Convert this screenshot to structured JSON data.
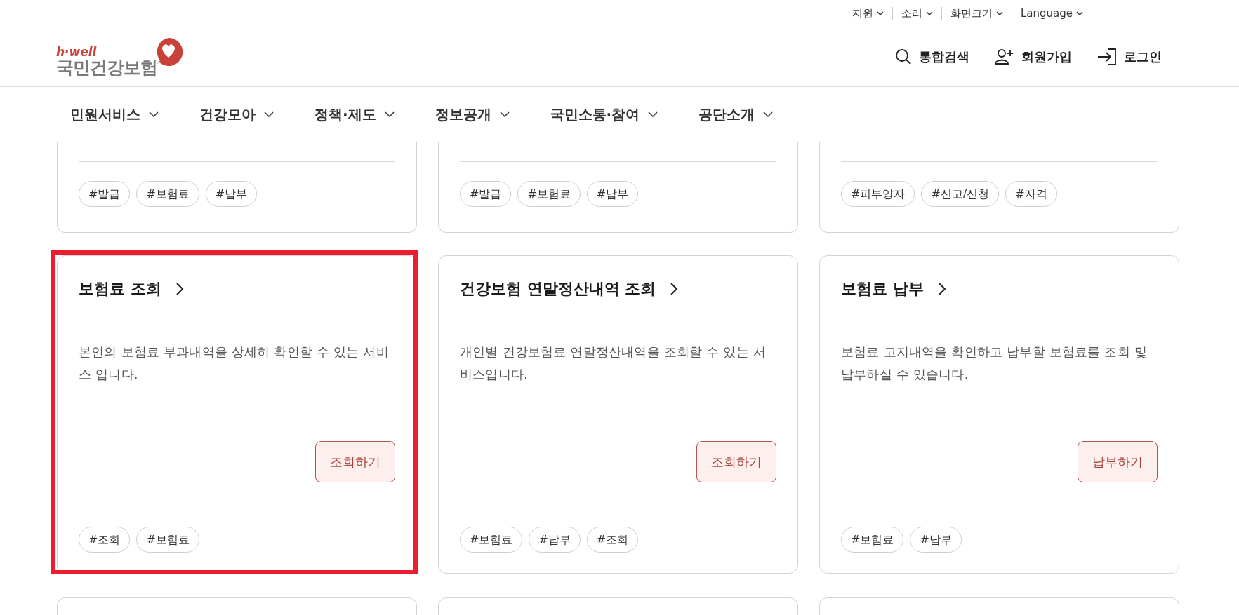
{
  "utility_menu": [
    {
      "label": "지원"
    },
    {
      "label": "소리"
    },
    {
      "label": "화면크기"
    },
    {
      "label": "Language"
    }
  ],
  "logo": {
    "tagline": "h·well",
    "name": "국민건강보험"
  },
  "header_actions": [
    {
      "label": "통합검색",
      "kind": "search"
    },
    {
      "label": "회원가입",
      "kind": "signup"
    },
    {
      "label": "로그인",
      "kind": "login"
    }
  ],
  "main_nav": [
    {
      "label": "민원서비스"
    },
    {
      "label": "건강모아"
    },
    {
      "label": "정책·제도"
    },
    {
      "label": "정보공개"
    },
    {
      "label": "국민소통·참여"
    },
    {
      "label": "공단소개"
    }
  ],
  "cards_top_row": [
    {
      "tags": [
        "#발급",
        "#보험료",
        "#납부"
      ]
    },
    {
      "tags": [
        "#발급",
        "#보험료",
        "#납부"
      ]
    },
    {
      "tags": [
        "#피부양자",
        "#신고/신청",
        "#자격"
      ]
    }
  ],
  "cards": [
    {
      "title": "보험료 조회",
      "description": "본인의 보험료 부과내역을 상세히 확인할 수 있는 서비스 입니다.",
      "button": "조회하기",
      "tags": [
        "#조회",
        "#보험료"
      ],
      "highlighted": true
    },
    {
      "title": "건강보험 연말정산내역 조회",
      "description": "개인별 건강보험료 연말정산내역을 조회할 수 있는 서비스입니다.",
      "button": "조회하기",
      "tags": [
        "#보험료",
        "#납부",
        "#조회"
      ],
      "highlighted": false
    },
    {
      "title": "보험료 납부",
      "description": "보험료 고지내역을 확인하고 납부할 보험료를 조회 및 납부하실 수 있습니다.",
      "button": "납부하기",
      "tags": [
        "#보험료",
        "#납부"
      ],
      "highlighted": false
    }
  ]
}
